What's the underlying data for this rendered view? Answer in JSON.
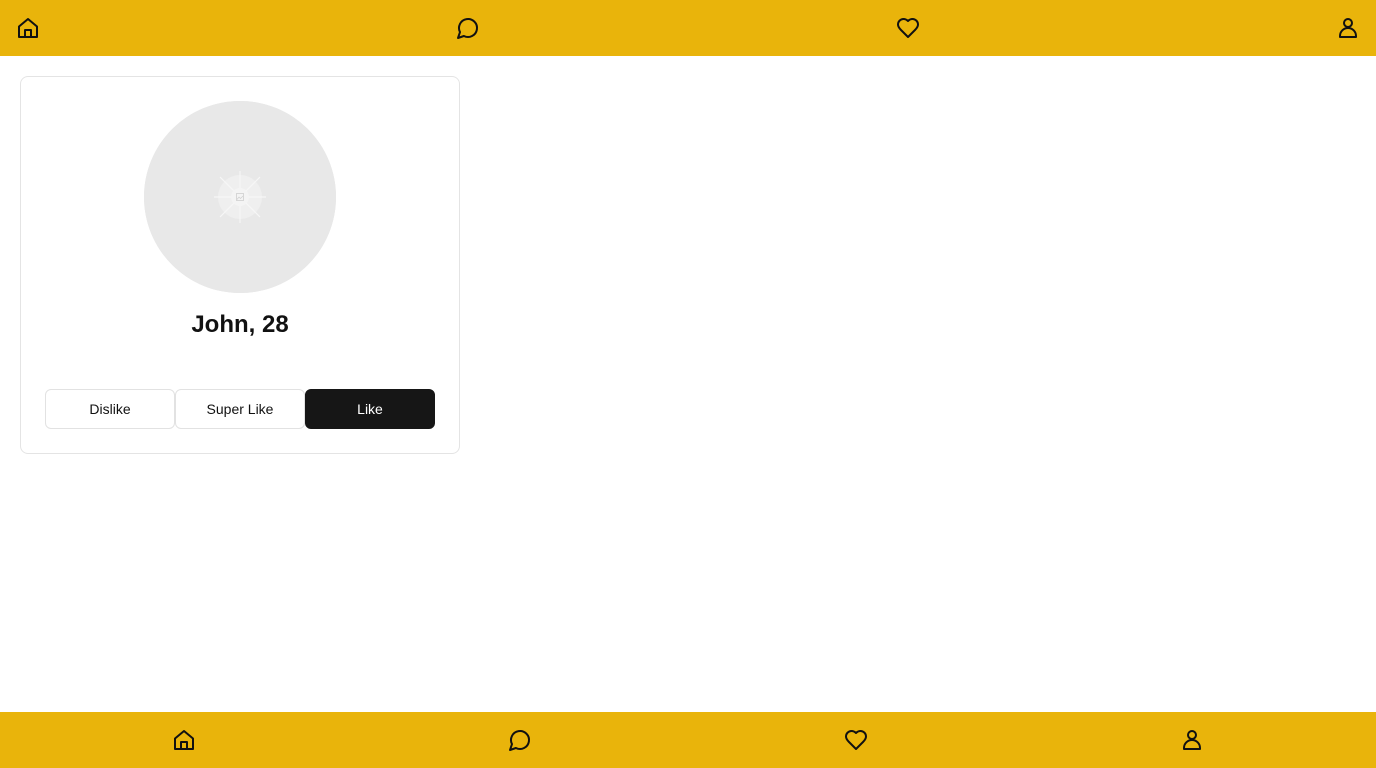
{
  "theme": {
    "nav_background": "#e9b40b",
    "primary_button": "#161616",
    "avatar_placeholder": "#e8e8e8"
  },
  "top_nav": {
    "items": [
      {
        "icon": "home-icon"
      },
      {
        "icon": "chat-icon"
      },
      {
        "icon": "heart-icon"
      },
      {
        "icon": "user-icon"
      }
    ]
  },
  "profile_card": {
    "avatar_icon": "image-placeholder-icon",
    "name_age": "John, 28",
    "actions": {
      "dislike": "Dislike",
      "super_like": "Super Like",
      "like": "Like"
    }
  },
  "bottom_nav": {
    "items": [
      {
        "icon": "home-icon"
      },
      {
        "icon": "chat-icon"
      },
      {
        "icon": "heart-icon"
      },
      {
        "icon": "user-icon"
      }
    ]
  }
}
